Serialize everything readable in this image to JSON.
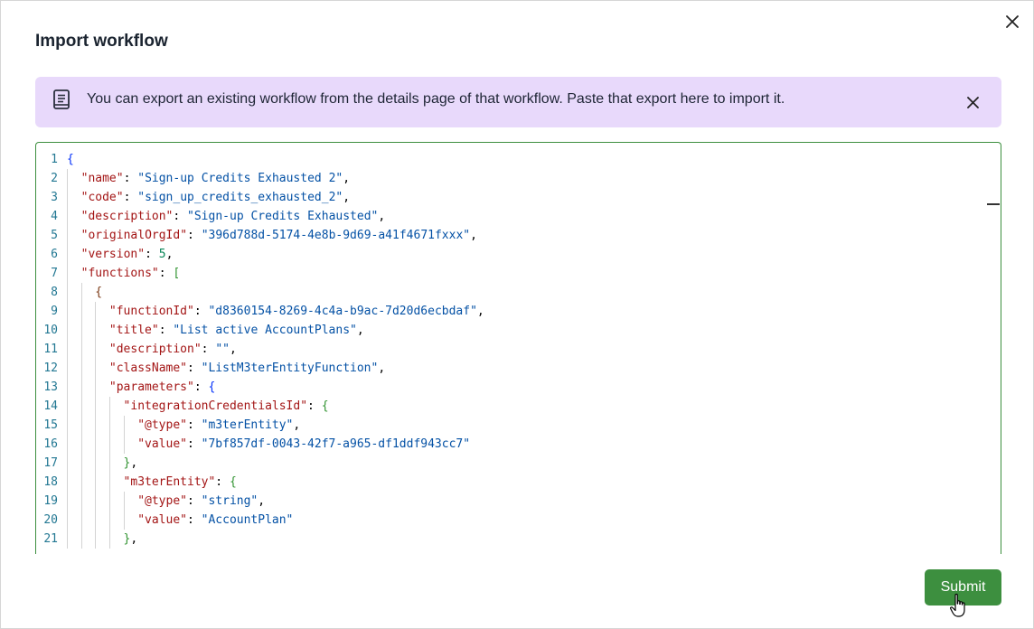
{
  "dialog": {
    "title": "Import workflow",
    "close_icon": "close-icon"
  },
  "banner": {
    "icon": "document-icon",
    "text": "You can export an existing workflow from the details page of that workflow. Paste that export here to import it.",
    "close_icon": "close-icon",
    "background": "#e8d9fb"
  },
  "editor": {
    "border_color": "#3d8f3f",
    "lines": [
      {
        "n": "1",
        "indent": 0,
        "tokens": [
          {
            "t": "{",
            "c": "b1"
          }
        ]
      },
      {
        "n": "2",
        "indent": 1,
        "tokens": [
          {
            "t": "\"name\"",
            "c": "key"
          },
          {
            "t": ": ",
            "c": "punc"
          },
          {
            "t": "\"Sign-up Credits Exhausted 2\"",
            "c": "str"
          },
          {
            "t": ",",
            "c": "punc"
          }
        ]
      },
      {
        "n": "3",
        "indent": 1,
        "tokens": [
          {
            "t": "\"code\"",
            "c": "key"
          },
          {
            "t": ": ",
            "c": "punc"
          },
          {
            "t": "\"sign_up_credits_exhausted_2\"",
            "c": "str"
          },
          {
            "t": ",",
            "c": "punc"
          }
        ]
      },
      {
        "n": "4",
        "indent": 1,
        "tokens": [
          {
            "t": "\"description\"",
            "c": "key"
          },
          {
            "t": ": ",
            "c": "punc"
          },
          {
            "t": "\"Sign-up Credits Exhausted\"",
            "c": "str"
          },
          {
            "t": ",",
            "c": "punc"
          }
        ]
      },
      {
        "n": "5",
        "indent": 1,
        "tokens": [
          {
            "t": "\"originalOrgId\"",
            "c": "key"
          },
          {
            "t": ": ",
            "c": "punc"
          },
          {
            "t": "\"396d788d-5174-4e8b-9d69-a41f4671fxxx\"",
            "c": "str"
          },
          {
            "t": ",",
            "c": "punc"
          }
        ]
      },
      {
        "n": "6",
        "indent": 1,
        "tokens": [
          {
            "t": "\"version\"",
            "c": "key"
          },
          {
            "t": ": ",
            "c": "punc"
          },
          {
            "t": "5",
            "c": "num"
          },
          {
            "t": ",",
            "c": "punc"
          }
        ]
      },
      {
        "n": "7",
        "indent": 1,
        "tokens": [
          {
            "t": "\"functions\"",
            "c": "key"
          },
          {
            "t": ": ",
            "c": "punc"
          },
          {
            "t": "[",
            "c": "b2"
          }
        ]
      },
      {
        "n": "8",
        "indent": 2,
        "tokens": [
          {
            "t": "{",
            "c": "b3"
          }
        ]
      },
      {
        "n": "9",
        "indent": 3,
        "tokens": [
          {
            "t": "\"functionId\"",
            "c": "key"
          },
          {
            "t": ": ",
            "c": "punc"
          },
          {
            "t": "\"d8360154-8269-4c4a-b9ac-7d20d6ecbdaf\"",
            "c": "str"
          },
          {
            "t": ",",
            "c": "punc"
          }
        ]
      },
      {
        "n": "10",
        "indent": 3,
        "tokens": [
          {
            "t": "\"title\"",
            "c": "key"
          },
          {
            "t": ": ",
            "c": "punc"
          },
          {
            "t": "\"List active AccountPlans\"",
            "c": "str"
          },
          {
            "t": ",",
            "c": "punc"
          }
        ]
      },
      {
        "n": "11",
        "indent": 3,
        "tokens": [
          {
            "t": "\"description\"",
            "c": "key"
          },
          {
            "t": ": ",
            "c": "punc"
          },
          {
            "t": "\"\"",
            "c": "str"
          },
          {
            "t": ",",
            "c": "punc"
          }
        ]
      },
      {
        "n": "12",
        "indent": 3,
        "tokens": [
          {
            "t": "\"className\"",
            "c": "key"
          },
          {
            "t": ": ",
            "c": "punc"
          },
          {
            "t": "\"ListM3terEntityFunction\"",
            "c": "str"
          },
          {
            "t": ",",
            "c": "punc"
          }
        ]
      },
      {
        "n": "13",
        "indent": 3,
        "tokens": [
          {
            "t": "\"parameters\"",
            "c": "key"
          },
          {
            "t": ": ",
            "c": "punc"
          },
          {
            "t": "{",
            "c": "b1"
          }
        ]
      },
      {
        "n": "14",
        "indent": 4,
        "tokens": [
          {
            "t": "\"integrationCredentialsId\"",
            "c": "key"
          },
          {
            "t": ": ",
            "c": "punc"
          },
          {
            "t": "{",
            "c": "b2"
          }
        ]
      },
      {
        "n": "15",
        "indent": 5,
        "tokens": [
          {
            "t": "\"@type\"",
            "c": "key"
          },
          {
            "t": ": ",
            "c": "punc"
          },
          {
            "t": "\"m3terEntity\"",
            "c": "str"
          },
          {
            "t": ",",
            "c": "punc"
          }
        ]
      },
      {
        "n": "16",
        "indent": 5,
        "tokens": [
          {
            "t": "\"value\"",
            "c": "key"
          },
          {
            "t": ": ",
            "c": "punc"
          },
          {
            "t": "\"7bf857df-0043-42f7-a965-df1ddf943cc7\"",
            "c": "str"
          }
        ]
      },
      {
        "n": "17",
        "indent": 4,
        "tokens": [
          {
            "t": "}",
            "c": "b2"
          },
          {
            "t": ",",
            "c": "punc"
          }
        ]
      },
      {
        "n": "18",
        "indent": 4,
        "tokens": [
          {
            "t": "\"m3terEntity\"",
            "c": "key"
          },
          {
            "t": ": ",
            "c": "punc"
          },
          {
            "t": "{",
            "c": "b2"
          }
        ]
      },
      {
        "n": "19",
        "indent": 5,
        "tokens": [
          {
            "t": "\"@type\"",
            "c": "key"
          },
          {
            "t": ": ",
            "c": "punc"
          },
          {
            "t": "\"string\"",
            "c": "str"
          },
          {
            "t": ",",
            "c": "punc"
          }
        ]
      },
      {
        "n": "20",
        "indent": 5,
        "tokens": [
          {
            "t": "\"value\"",
            "c": "key"
          },
          {
            "t": ": ",
            "c": "punc"
          },
          {
            "t": "\"AccountPlan\"",
            "c": "str"
          }
        ]
      },
      {
        "n": "21",
        "indent": 4,
        "tokens": [
          {
            "t": "}",
            "c": "b2"
          },
          {
            "t": ",",
            "c": "punc"
          }
        ]
      }
    ]
  },
  "footer": {
    "submit_label": "Submit",
    "submit_color": "#3d8f3f",
    "cursor_icon": "hand-pointer-icon"
  }
}
